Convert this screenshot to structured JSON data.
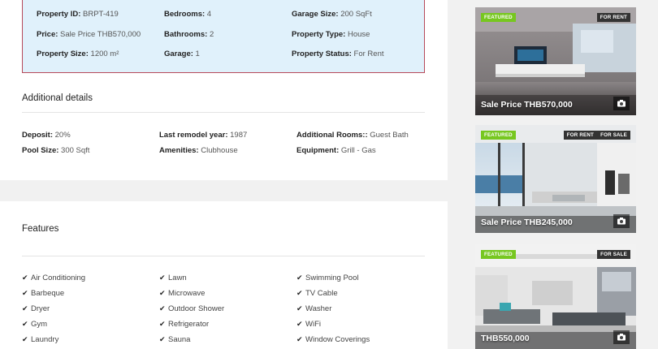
{
  "overview": {
    "property_id": {
      "label": "Property ID:",
      "value": "BRPT-419"
    },
    "bedrooms": {
      "label": "Bedrooms:",
      "value": "4"
    },
    "garage_size": {
      "label": "Garage Size:",
      "value": "200 SqFt"
    },
    "price": {
      "label": "Price:",
      "value": "Sale Price THB570,000"
    },
    "bathrooms": {
      "label": "Bathrooms:",
      "value": "2"
    },
    "property_type": {
      "label": "Property Type:",
      "value": "House"
    },
    "property_size": {
      "label": "Property Size:",
      "value": "1200 m²"
    },
    "garage": {
      "label": "Garage:",
      "value": "1"
    },
    "property_status": {
      "label": "Property Status:",
      "value": "For Rent"
    }
  },
  "additional_details": {
    "title": "Additional details",
    "deposit": {
      "label": "Deposit:",
      "value": "20%"
    },
    "last_remodel": {
      "label": "Last remodel year:",
      "value": "1987"
    },
    "additional_rooms": {
      "label": "Additional Rooms::",
      "value": "Guest Bath"
    },
    "pool_size": {
      "label": "Pool Size:",
      "value": "300 Sqft"
    },
    "amenities": {
      "label": "Amenities:",
      "value": "Clubhouse"
    },
    "equipment": {
      "label": "Equipment:",
      "value": "Grill - Gas"
    }
  },
  "features": {
    "title": "Features",
    "items": [
      "Air Conditioning",
      "Lawn",
      "Swimming Pool",
      "Barbeque",
      "Microwave",
      "TV Cable",
      "Dryer",
      "Outdoor Shower",
      "Washer",
      "Gym",
      "Refrigerator",
      "WiFi",
      "Laundry",
      "Sauna",
      "Window Coverings"
    ]
  },
  "listings": [
    {
      "featured": "FEATURED",
      "tags": [
        "FOR RENT"
      ],
      "price": "Sale Price THB570,000"
    },
    {
      "featured": "FEATURED",
      "tags": [
        "FOR RENT",
        "FOR SALE"
      ],
      "price": "Sale Price THB245,000"
    },
    {
      "featured": "FEATURED",
      "tags": [
        "FOR SALE"
      ],
      "price": "THB550,000"
    }
  ],
  "icons": {
    "check": "check-icon",
    "camera": "camera-icon"
  },
  "colors": {
    "featured_badge": "#77c720",
    "overview_bg": "#e0f1fb",
    "overview_border": "#b74a5a",
    "status_badge": "#333333"
  }
}
